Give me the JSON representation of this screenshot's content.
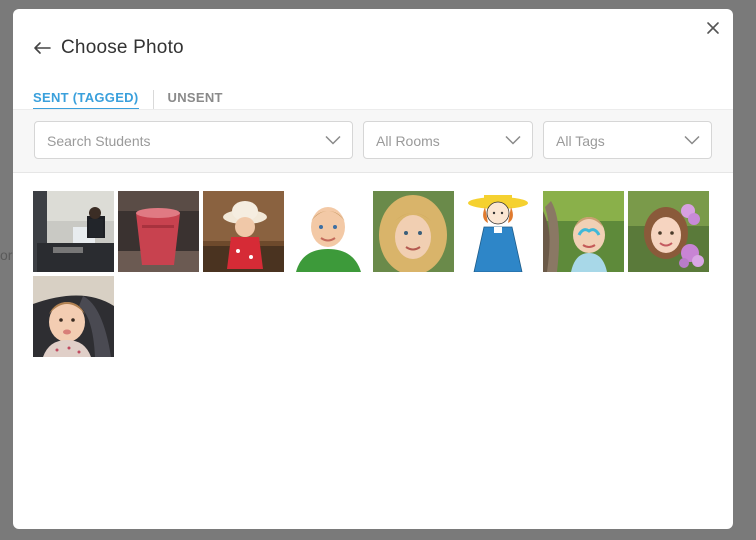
{
  "backdrop": {
    "partial_text": "or"
  },
  "dialog": {
    "title": "Choose Photo",
    "back_icon": "arrow-left-icon",
    "close_icon": "close-icon"
  },
  "tabs": [
    {
      "label": "SENT (TAGGED)",
      "active": true
    },
    {
      "label": "UNSENT",
      "active": false
    }
  ],
  "filters": {
    "students": {
      "placeholder": "Search Students"
    },
    "rooms": {
      "selected": "All Rooms"
    },
    "tags": {
      "selected": "All Tags"
    }
  },
  "photos": [
    {
      "subject": "man at computer desk"
    },
    {
      "subject": "red drink cup"
    },
    {
      "subject": "toddler in hat and red outfit"
    },
    {
      "subject": "smiling boy in green shirt"
    },
    {
      "subject": "blonde girl portrait"
    },
    {
      "subject": "cartoon girl in yellow hat"
    },
    {
      "subject": "girl with face paint by tree"
    },
    {
      "subject": "girl with flowers"
    },
    {
      "subject": "baby in car seat"
    }
  ],
  "colors": {
    "accent": "#3aa0dc",
    "overlay": "#7a7a7a"
  }
}
